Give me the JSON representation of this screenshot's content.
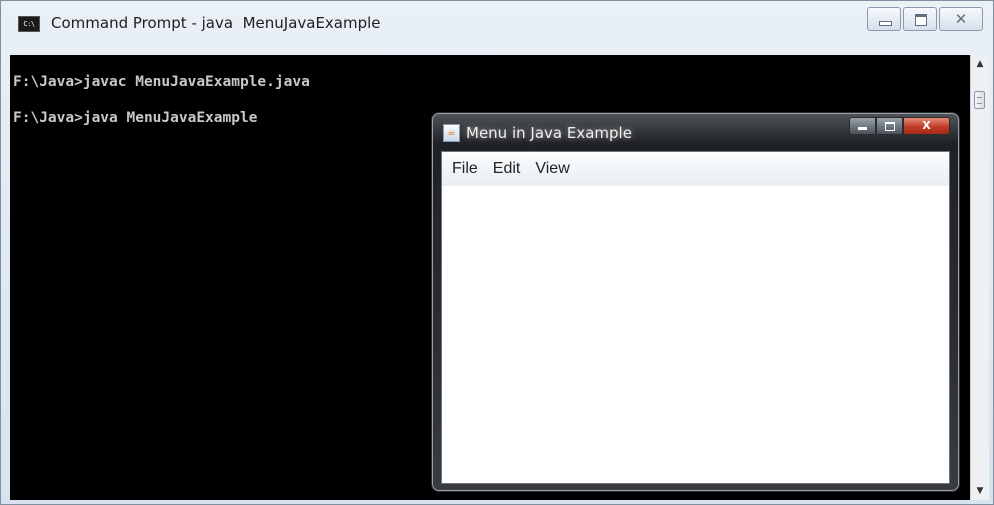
{
  "cmd_window": {
    "icon_text": "C:\\",
    "title": "Command Prompt - java  MenuJavaExample",
    "close_glyph": "✕",
    "console_lines": [
      "F:\\Java>javac MenuJavaExample.java",
      "F:\\Java>java MenuJavaExample"
    ],
    "scroll_up_glyph": "▲",
    "scroll_down_glyph": "▼"
  },
  "java_window": {
    "icon_glyph": "☕",
    "title": "Menu in Java Example",
    "close_glyph": "X",
    "menus": [
      "File",
      "Edit",
      "View"
    ]
  }
}
